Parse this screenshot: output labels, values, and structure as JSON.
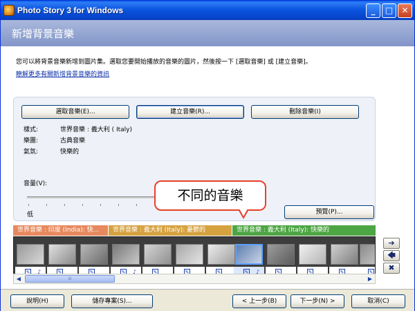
{
  "window": {
    "title": "Photo Story 3 for Windows"
  },
  "header": {
    "title": "新增背景音樂"
  },
  "instructions": "您可以將背景音樂新增到圖片集。選取您要開始播放的音樂的圖片，然後按一下 [選取音樂] 或 [建立音樂]。",
  "more_link": "瞭解更多有關新增背景音樂的資訊",
  "music_buttons": {
    "select": "選取音樂(E)...",
    "create": "建立音樂(R)...",
    "delete": "刪除音樂(I)"
  },
  "properties": [
    {
      "label": "樣式:",
      "value": "世界音樂 : 義大利 ( Italy)"
    },
    {
      "label": "樂團:",
      "value": "古典音樂"
    },
    {
      "label": "氣氛:",
      "value": "快樂的"
    }
  ],
  "volume": {
    "label": "音量(V):",
    "low_label": "低",
    "level": 0.5
  },
  "preview_button": "預覽(P)...",
  "callout": "不同的音樂",
  "music_bands": [
    {
      "label": "世界音樂 : 印度 (India): 快...",
      "color": "#E7895E"
    },
    {
      "label": "世界音樂 : 義大利 (Italy): 憂鬱的",
      "color": "#D6A240"
    },
    {
      "label": "世界音樂 : 義大利 (Italy): 快樂的",
      "color": "#4EA544"
    }
  ],
  "scrollbar_grip": "iii",
  "side_buttons": {
    "right": "➔",
    "left": "🡄",
    "remove": "✖"
  },
  "footer": {
    "help": "說明(H)",
    "save": "儲存專案(S)...",
    "back": "< 上一步(B)",
    "next": "下一步(N) >",
    "cancel": "取消(C)"
  },
  "window_controls": {
    "minimize": "_",
    "maximize": "□",
    "close": "✕"
  },
  "icons": {
    "edit": "✎",
    "music_note": "♪"
  }
}
